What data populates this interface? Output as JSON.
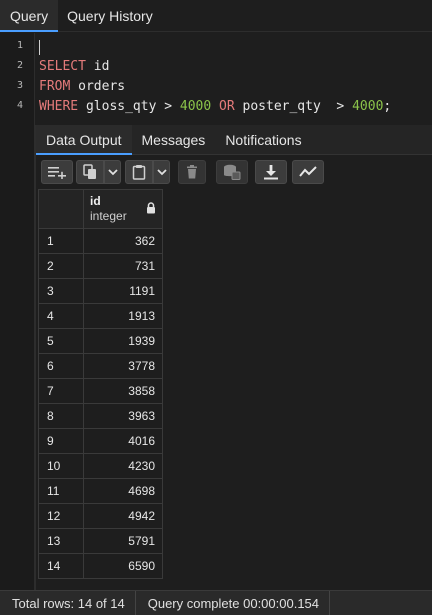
{
  "top_tabs": [
    "Query",
    "Query History"
  ],
  "editor": {
    "line_numbers": [
      "1",
      "2",
      "3",
      "4"
    ],
    "lines": [
      [],
      [
        {
          "t": "SELECT",
          "k": "kw"
        },
        {
          "t": " id",
          "k": ""
        }
      ],
      [
        {
          "t": "FROM",
          "k": "kw"
        },
        {
          "t": " orders",
          "k": ""
        }
      ],
      [
        {
          "t": "WHERE",
          "k": "kw"
        },
        {
          "t": " gloss_qty > ",
          "k": ""
        },
        {
          "t": "4000",
          "k": "num"
        },
        {
          "t": " ",
          "k": ""
        },
        {
          "t": "OR",
          "k": "kw"
        },
        {
          "t": " poster_qty  > ",
          "k": ""
        },
        {
          "t": "4000",
          "k": "num"
        },
        {
          "t": ";",
          "k": ""
        }
      ]
    ]
  },
  "panel_tabs": [
    "Data Output",
    "Messages",
    "Notifications"
  ],
  "toolbar_icons": [
    "add-row-icon",
    "copy-icon",
    "paste-icon",
    "delete-icon",
    "save-data-icon",
    "download-icon",
    "graph-icon"
  ],
  "grid": {
    "column": {
      "name": "id",
      "type": "integer"
    },
    "rows": [
      {
        "n": "1",
        "id": "362"
      },
      {
        "n": "2",
        "id": "731"
      },
      {
        "n": "3",
        "id": "1191"
      },
      {
        "n": "4",
        "id": "1913"
      },
      {
        "n": "5",
        "id": "1939"
      },
      {
        "n": "6",
        "id": "3778"
      },
      {
        "n": "7",
        "id": "3858"
      },
      {
        "n": "8",
        "id": "3963"
      },
      {
        "n": "9",
        "id": "4016"
      },
      {
        "n": "10",
        "id": "4230"
      },
      {
        "n": "11",
        "id": "4698"
      },
      {
        "n": "12",
        "id": "4942"
      },
      {
        "n": "13",
        "id": "5791"
      },
      {
        "n": "14",
        "id": "6590"
      }
    ]
  },
  "status": {
    "total_rows": "Total rows: 14 of 14",
    "query_complete": "Query complete 00:00:00.154"
  },
  "colors": {
    "accent": "#4a9eff",
    "keyword": "#e57b7b",
    "number": "#8bc34a"
  }
}
